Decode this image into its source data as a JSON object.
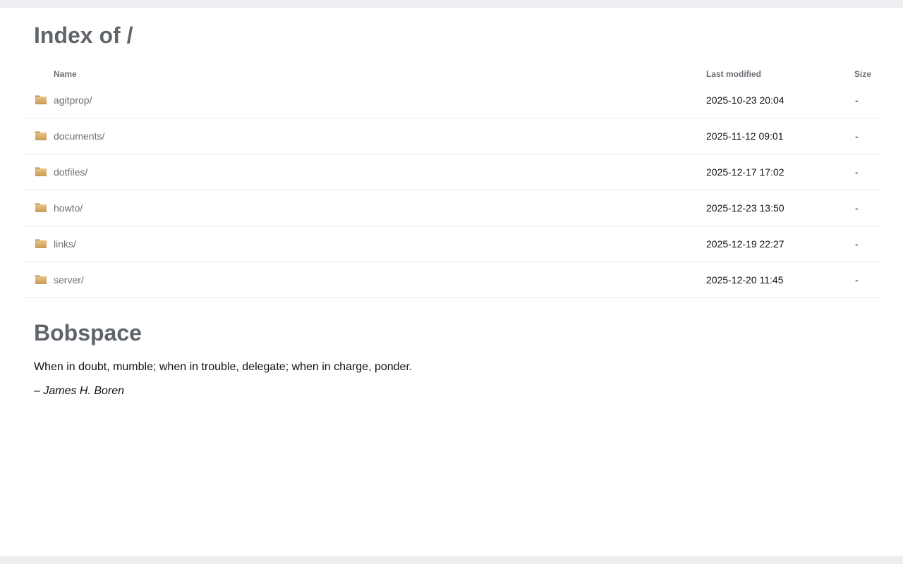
{
  "title": "Index of /",
  "columns": {
    "name": "Name",
    "modified": "Last modified",
    "size": "Size"
  },
  "entries": [
    {
      "name": "agitprop/",
      "modified": "2025-10-23 20:04",
      "size": "-"
    },
    {
      "name": "documents/",
      "modified": "2025-11-12 09:01",
      "size": "-"
    },
    {
      "name": "dotfiles/",
      "modified": "2025-12-17 17:02",
      "size": "-"
    },
    {
      "name": "howto/",
      "modified": "2025-12-23 13:50",
      "size": "-"
    },
    {
      "name": "links/",
      "modified": "2025-12-19 22:27",
      "size": "-"
    },
    {
      "name": "server/",
      "modified": "2025-12-20 11:45",
      "size": "-"
    }
  ],
  "icons": {
    "entry": "folder-icon"
  },
  "readme": {
    "heading": "Bobspace",
    "quote": "When in doubt, mumble; when in trouble, delegate; when in charge, ponder.",
    "dash": "–",
    "author": "James H. Boren"
  },
  "colors": {
    "page_background": "#eceef1",
    "content_background": "#ffffff",
    "heading": "#60656b",
    "link": "#6b6f74",
    "row_divider": "#e9ebee",
    "folder": "#d9ab64"
  }
}
